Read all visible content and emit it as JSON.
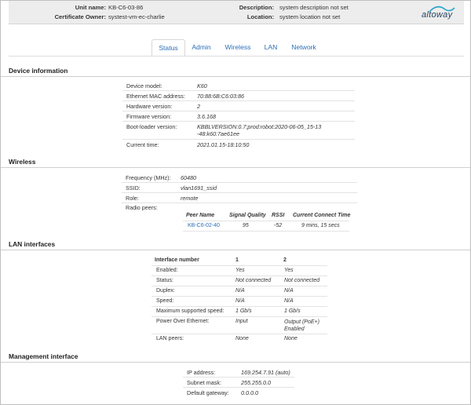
{
  "header": {
    "unit_name_label": "Unit name:",
    "unit_name": "KB-C6-03-86",
    "cert_owner_label": "Certificate Owner:",
    "cert_owner": "systest-vm-ec-charlie",
    "description_label": "Description:",
    "description": "system description not set",
    "location_label": "Location:",
    "location": "system location not set",
    "logo_text": "altoway"
  },
  "tabs": [
    "Status",
    "Admin",
    "Wireless",
    "LAN",
    "Network"
  ],
  "active_tab": "Status",
  "device_info": {
    "title": "Device information",
    "rows": [
      {
        "label": "Device model:",
        "value": "K60"
      },
      {
        "label": "Ethernet MAC address:",
        "value": "70:88:6B:C6:03:86"
      },
      {
        "label": "Hardware version:",
        "value": "2"
      },
      {
        "label": "Firmware version:",
        "value": "3.6.168"
      },
      {
        "label": "Boot-loader version:",
        "value": "KBBLVERSION:0.7;prod:robot:2020-06-05_15-13-48:k60:7ae61ee"
      },
      {
        "label": "Current time:",
        "value": "2021.01.15-18:10:50"
      }
    ]
  },
  "wireless": {
    "title": "Wireless",
    "rows": [
      {
        "label": "Frequency (MHz):",
        "value": "60480"
      },
      {
        "label": "SSID:",
        "value": "vlan1691_ssid"
      },
      {
        "label": "Role:",
        "value": "remote"
      },
      {
        "label": "Radio peers:",
        "value": ""
      }
    ],
    "peers": {
      "headers": [
        "Peer Name",
        "Signal Quality",
        "RSSI",
        "Current Connect Time"
      ],
      "rows": [
        {
          "name": "KB-C6-02-40",
          "signal": "95",
          "rssi": "-52",
          "time": "9 mins, 15 secs"
        }
      ]
    }
  },
  "lan": {
    "title": "LAN interfaces",
    "headers": [
      "Interface number",
      "1",
      "2"
    ],
    "rows": [
      {
        "label": "Enabled:",
        "v1": "Yes",
        "v2": "Yes"
      },
      {
        "label": "Status:",
        "v1": "Not connected",
        "v2": "Not connected"
      },
      {
        "label": "Duplex:",
        "v1": "N/A",
        "v2": "N/A"
      },
      {
        "label": "Speed:",
        "v1": "N/A",
        "v2": "N/A"
      },
      {
        "label": "Maximum supported speed:",
        "v1": "1 Gb/s",
        "v2": "1 Gb/s"
      },
      {
        "label": "Power Over Ethernet:",
        "v1": "Input",
        "v2": "Output (PoE+) Enabled"
      },
      {
        "label": "LAN peers:",
        "v1": "None",
        "v2": "None"
      }
    ]
  },
  "mgmt": {
    "title": "Management interface",
    "rows": [
      {
        "label": "IP address:",
        "value": "169.254.7.91 (auto)"
      },
      {
        "label": "Subnet mask:",
        "value": "255.255.0.0"
      },
      {
        "label": "Default gateway:",
        "value": "0.0.0.0"
      }
    ]
  }
}
